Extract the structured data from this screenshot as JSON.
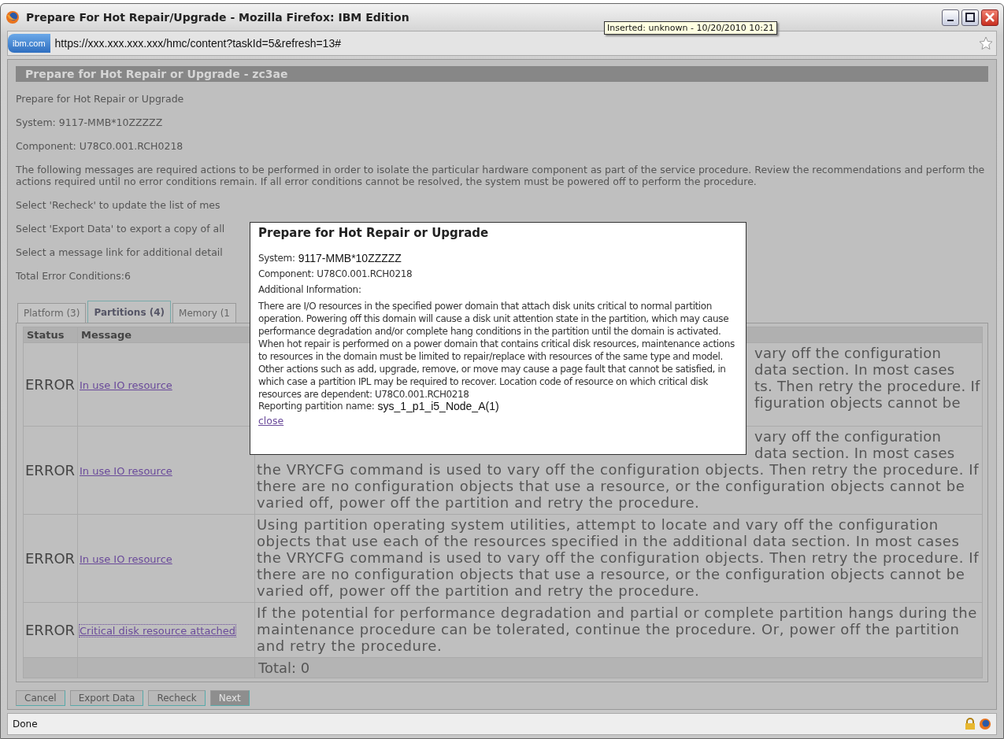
{
  "window": {
    "title": "Prepare For Hot Repair/Upgrade - Mozilla Firefox: IBM Edition"
  },
  "tooltip": "Inserted: unknown - 10/20/2010 10:21",
  "address_bar": {
    "site_badge": "ibm.com",
    "url": "https://xxx.xxx.xxx.xxx/hmc/content?taskId=5&refresh=13#"
  },
  "page": {
    "header": "Prepare for Hot Repair or Upgrade - zc3ae",
    "lines": [
      "Prepare for Hot Repair or Upgrade",
      "System: 9117-MMB*10ZZZZZ",
      "Component: U78C0.001.RCH0218",
      "The following messages are required actions to be performed in order to isolate the particular hardware component as part of the service procedure. Review the recommendations and perform the actions required until no error conditions remain. If all error conditions cannot be resolved, the system must be powered off to perform the procedure.",
      "Select 'Recheck' to update the list of mes",
      "Select 'Export Data' to export a copy of all",
      "Select a message link for additional detail",
      "Total Error Conditions:6"
    ]
  },
  "tabs": [
    {
      "label": "Platform (3)",
      "selected": false
    },
    {
      "label": "Partitions (4)",
      "selected": true
    },
    {
      "label": "Memory (1",
      "selected": false
    }
  ],
  "table": {
    "columns": [
      "Status",
      "Message"
    ],
    "rows": [
      {
        "status": "ERROR",
        "message": "In use IO resource",
        "focused": false,
        "lines": [
          {
            "text": "vary off the configuration",
            "partial": true
          },
          {
            "text": "data section. In most cases",
            "partial": true
          },
          {
            "text": "ts. Then retry the procedure. If",
            "partial": true
          },
          {
            "text": "figuration objects cannot be",
            "partial": true
          }
        ]
      },
      {
        "status": "ERROR",
        "message": "In use IO resource",
        "focused": false,
        "lines": [
          {
            "text": "vary off the configuration",
            "partial": true
          },
          {
            "text": "data section. In most cases",
            "partial": true
          },
          {
            "text": "the VRYCFG command is used to vary off the configuration objects. Then retry the procedure. If",
            "partial": false
          },
          {
            "text": "there are no configuration objects that use a resource, or the configuration objects cannot be",
            "partial": false
          },
          {
            "text": "varied off, power off the partition and retry the procedure.",
            "partial": false
          }
        ]
      },
      {
        "status": "ERROR",
        "message": "In use IO resource",
        "focused": false,
        "lines": [
          {
            "text": "Using partition operating system utilities, attempt to locate and vary off the configuration",
            "partial": false
          },
          {
            "text": "objects that use each of the resources specified in the additional data section. In most cases",
            "partial": false
          },
          {
            "text": "the VRYCFG command is used to vary off the configuration objects. Then retry the procedure. If",
            "partial": false
          },
          {
            "text": "there are no configuration objects that use a resource, or the configuration objects cannot be",
            "partial": false
          },
          {
            "text": "varied off, power off the partition and retry the procedure.",
            "partial": false
          }
        ]
      },
      {
        "status": "ERROR",
        "message": "Critical disk resource attached",
        "focused": true,
        "lines": [
          {
            "text": "If the potential for performance degradation and partial or complete partition hangs during the",
            "partial": false
          },
          {
            "text": "maintenance procedure can be tolerated, continue the procedure. Or, power off the partition",
            "partial": false
          },
          {
            "text": "and retry the procedure.",
            "partial": false
          }
        ]
      }
    ],
    "total": "Total: 0"
  },
  "buttons": [
    {
      "label": "Cancel",
      "disabled": false
    },
    {
      "label": "Export Data",
      "disabled": false
    },
    {
      "label": "Recheck",
      "disabled": false
    },
    {
      "label": "Next",
      "disabled": true
    }
  ],
  "popup": {
    "title": "Prepare for Hot Repair or Upgrade",
    "system_label": "System:",
    "system_value": "9117-MMB*10ZZZZZ",
    "component": "Component: U78C0.001.RCH0218",
    "additional_label": "Additional Information:",
    "details": "There are I/O resources in the specified power domain that attach disk units critical to normal partition operation. Powering off this domain will cause a disk unit attention state in the partition, which may cause performance degradation and/or complete hang conditions in the partition until the domain is activated. When hot repair is performed on a power domain that contains critical disk resources, maintenance actions to resources in the domain must be limited to repair/replace with resources of the same type and model. Other actions such as add, upgrade, remove, or move may cause a page fault that cannot be satisfied, in which case a partition IPL may be required to recover. Location code of resource on which critical disk resources are dependent: U78C0.001.RCH0218",
    "partition_label": "Reporting partition name:",
    "partition_value": "sys_1_p1_i5_Node_A(1)",
    "close": "close"
  },
  "status_bar": "Done"
}
